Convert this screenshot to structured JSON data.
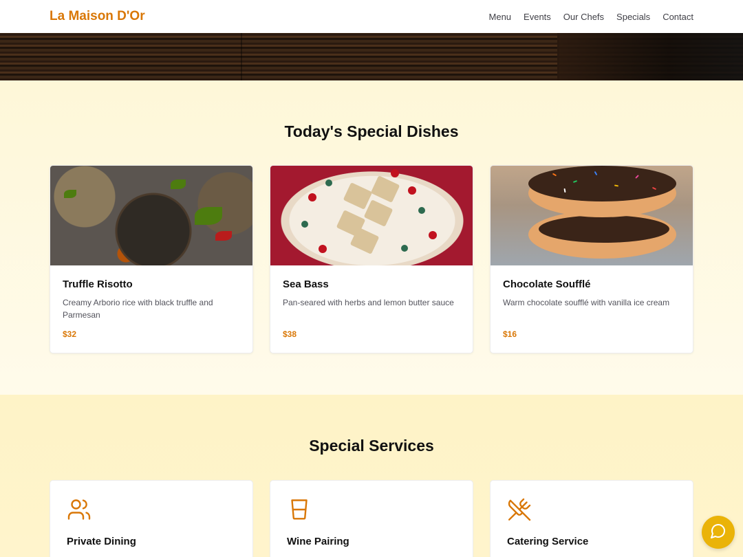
{
  "header": {
    "brand": "La Maison D'Or",
    "nav": [
      "Menu",
      "Events",
      "Our Chefs",
      "Specials",
      "Contact"
    ]
  },
  "dishes": {
    "title": "Today's Special Dishes",
    "items": [
      {
        "name": "Truffle Risotto",
        "description": "Creamy Arborio rice with black truffle and Parmesan",
        "price": "$32"
      },
      {
        "name": "Sea Bass",
        "description": "Pan-seared with herbs and lemon butter sauce",
        "price": "$38"
      },
      {
        "name": "Chocolate Soufflé",
        "description": "Warm chocolate soufflé with vanilla ice cream",
        "price": "$16"
      }
    ]
  },
  "services": {
    "title": "Special Services",
    "items": [
      {
        "name": "Private Dining",
        "icon": "users-icon"
      },
      {
        "name": "Wine Pairing",
        "icon": "glass-icon"
      },
      {
        "name": "Catering Service",
        "icon": "utensils-crossed-icon"
      }
    ]
  },
  "chat": {
    "icon": "chat-bubble-icon"
  },
  "colors": {
    "accent": "#d97706",
    "chat": "#eab308",
    "dishes_bg": "#fef9e1",
    "services_bg": "#fef3c7"
  }
}
